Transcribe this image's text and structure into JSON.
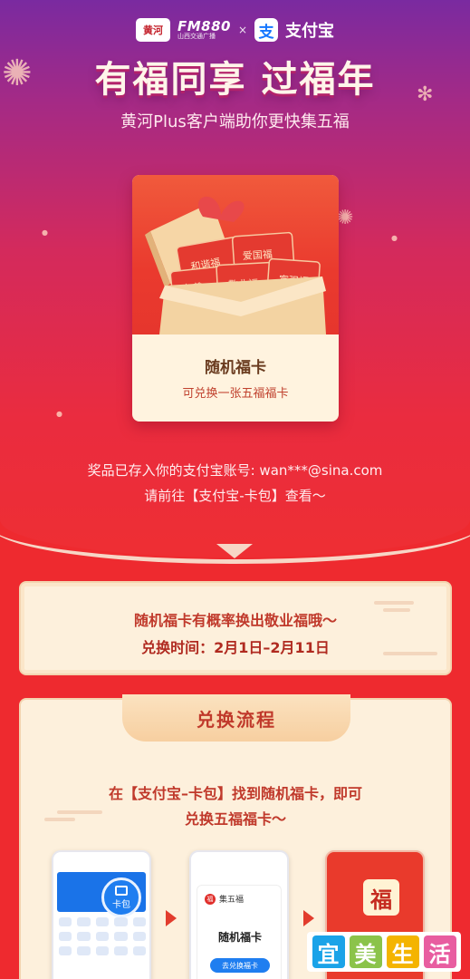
{
  "header": {
    "logo_text": "黄河",
    "fm_brand": "FM880",
    "fm_subtitle": "山西交通广播",
    "times": "×",
    "alipay_mark": "支",
    "alipay_name": "支付宝"
  },
  "hero": {
    "title": "有福同享 过福年",
    "subtitle": "黄河Plus客户端助你更快集五福"
  },
  "prize": {
    "title": "随机福卡",
    "description": "可兑换一张五福福卡",
    "card_labels": [
      "和谐福",
      "爱国福",
      "友善",
      "敬业福",
      "富强福"
    ]
  },
  "notice": {
    "line1": "奖品已存入你的支付宝账号: wan***@sina.com",
    "line2": "请前往【支付宝-卡包】查看～"
  },
  "info": {
    "line1": "随机福卡有概率换出敬业福哦～",
    "line2": "兑换时间：2月1日–2月11日"
  },
  "process": {
    "title": "兑换流程",
    "text1": "在【支付宝–卡包】找到随机福卡，即可",
    "text2": "兑换五福福卡～",
    "badge_label": "卡包",
    "phone2_app": "集五福",
    "phone2_title": "随机福卡",
    "phone2_button": "去兑换福卡",
    "phone3_char": "福"
  },
  "watermark": {
    "chars": [
      "宜",
      "美",
      "生",
      "活"
    ],
    "colors": [
      "#1aa3e8",
      "#8bc34a",
      "#f4b400",
      "#e85da0"
    ]
  },
  "colors": {
    "accent_red": "#ee2a2f",
    "purple_top": "#7a2aa0",
    "cream": "#fdf0dc",
    "alipay_blue": "#1677ff"
  }
}
